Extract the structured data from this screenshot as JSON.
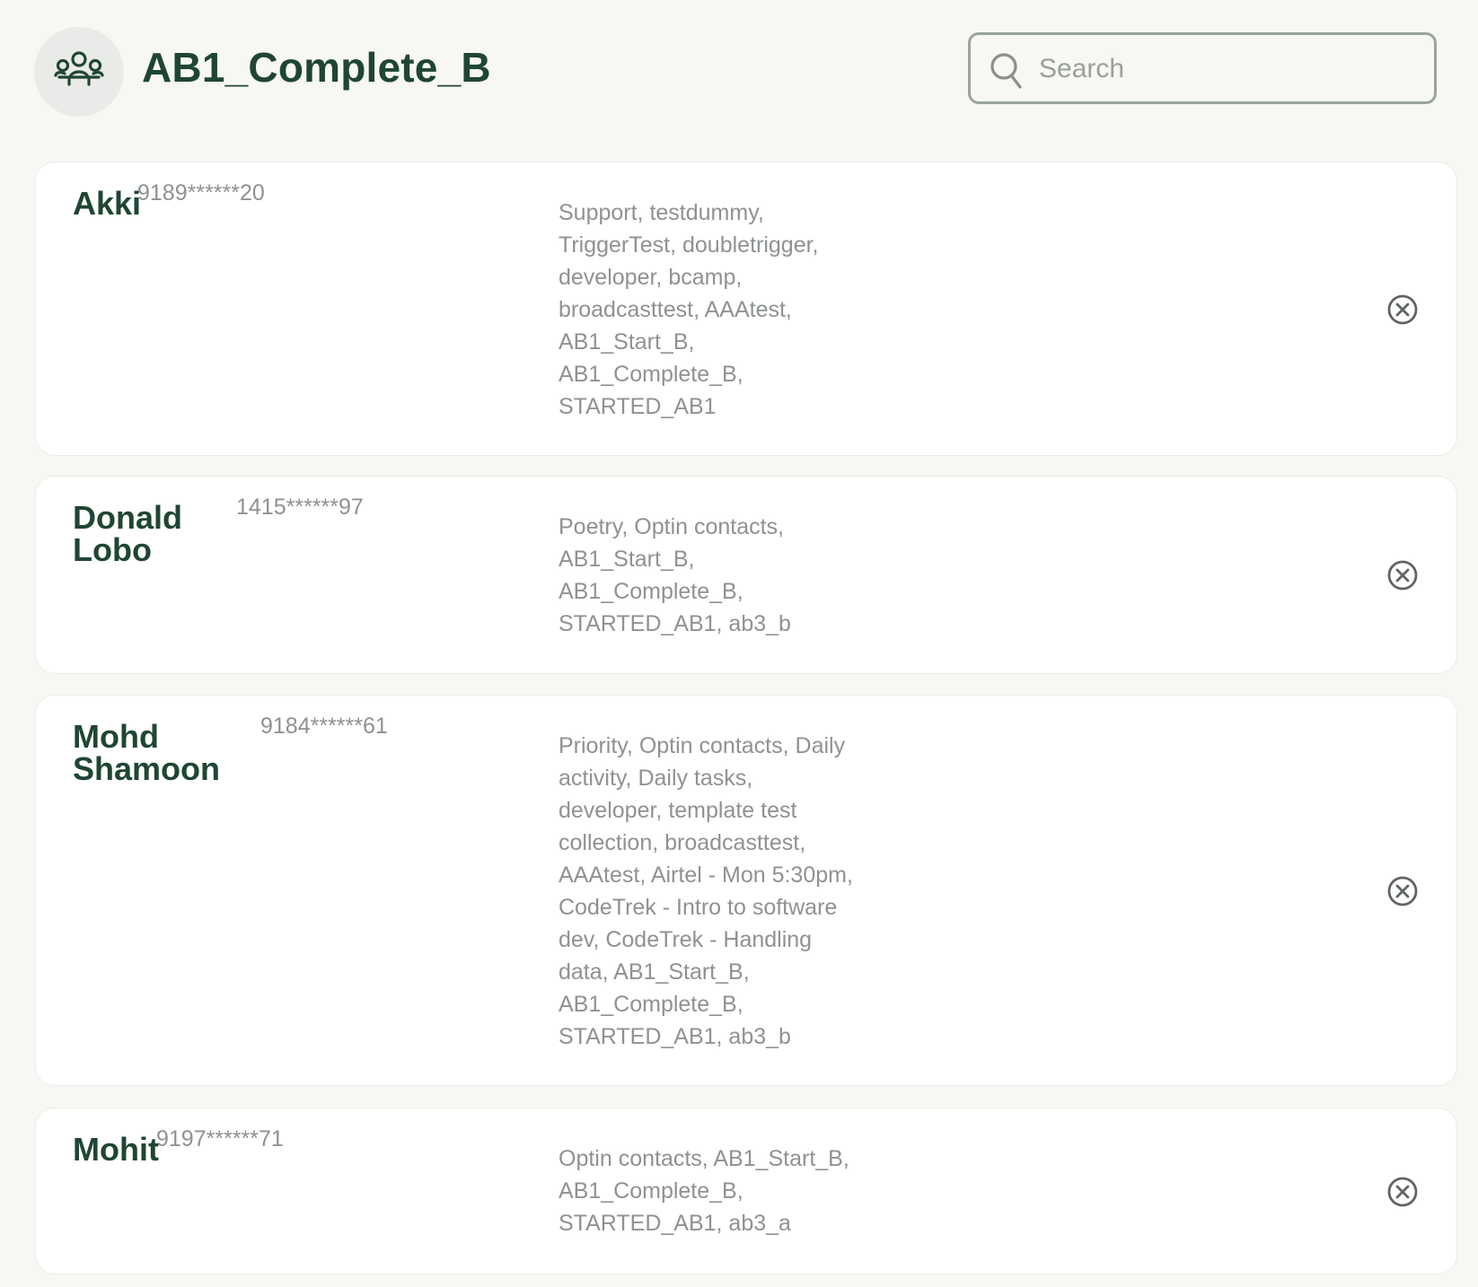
{
  "header": {
    "group_icon": "group-icon",
    "title": "AB1_Complete_B"
  },
  "search": {
    "placeholder": "Search",
    "value": "",
    "icon": "search-icon"
  },
  "contacts": [
    {
      "name": "Akki",
      "phone": "9189******20",
      "tags": "Support, testdummy, TriggerTest, doubletrigger, developer, bcamp, broadcasttest, AAAtest, AB1_Start_B, AB1_Complete_B, STARTED_AB1",
      "remove_icon": "close-circle-icon"
    },
    {
      "name": "Donald Lobo",
      "phone": "1415******97",
      "tags": "Poetry, Optin contacts, AB1_Start_B, AB1_Complete_B, STARTED_AB1, ab3_b",
      "remove_icon": "close-circle-icon"
    },
    {
      "name": "Mohd Shamoon",
      "phone": "9184******61",
      "tags": "Priority, Optin contacts, Daily activity, Daily tasks, developer, template test collection, broadcasttest, AAAtest, Airtel - Mon 5:30pm, CodeTrek - Intro to software dev, CodeTrek - Handling data, AB1_Start_B, AB1_Complete_B, STARTED_AB1, ab3_b",
      "remove_icon": "close-circle-icon"
    },
    {
      "name": "Mohit",
      "phone": "9197******71",
      "tags": "Optin contacts, AB1_Start_B, AB1_Complete_B, STARTED_AB1, ab3_a",
      "remove_icon": "close-circle-icon"
    }
  ],
  "colors": {
    "background": "#f7f7f4",
    "primary_text": "#1f4633",
    "secondary_text": "#8e938f",
    "card": "#ffffff"
  }
}
